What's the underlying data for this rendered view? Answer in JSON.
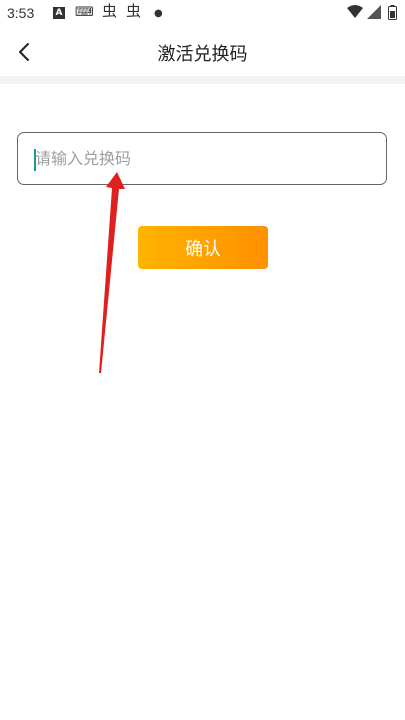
{
  "status_bar": {
    "time": "3:53",
    "icons": [
      "a-notification-icon",
      "keyboard-icon",
      "bug-icon",
      "bug-icon",
      "dot-icon",
      "wifi-icon",
      "signal-icon",
      "battery-icon"
    ]
  },
  "header": {
    "title": "激活兑换码",
    "back_icon": "chevron-left-icon"
  },
  "form": {
    "code_input": {
      "value": "",
      "placeholder": "请输入兑换码"
    },
    "confirm_label": "确认"
  },
  "colors": {
    "button_gradient_start": "#ffb400",
    "button_gradient_end": "#ff9000",
    "input_border": "#666666",
    "caret": "#1a9a8a",
    "annotation_arrow": "#e02020",
    "separator": "#f2f2f2"
  }
}
